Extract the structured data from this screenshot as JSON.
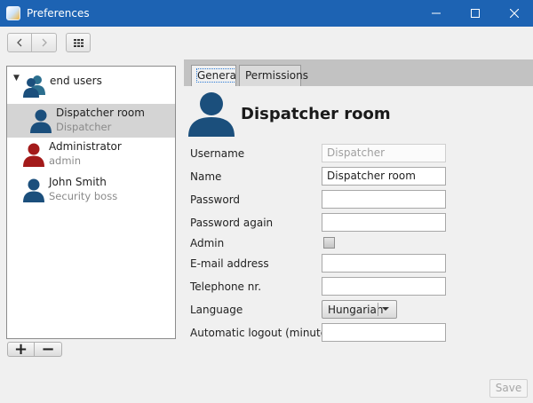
{
  "window": {
    "title": "Preferences",
    "controls": [
      "minimize-icon",
      "maximize-icon",
      "close-icon"
    ]
  },
  "toolbar": {
    "buttons": [
      "back-arrow-icon",
      "forward-arrow-icon",
      "grid-menu-icon"
    ]
  },
  "tree": {
    "root_label": "end users",
    "items": [
      {
        "name": "Dispatcher room",
        "role": "Dispatcher",
        "selected": true,
        "icon_color": "#1b4f7c"
      },
      {
        "name": "Administrator",
        "role": "admin",
        "selected": false,
        "icon_color": "#a31a1a"
      },
      {
        "name": "John Smith",
        "role": "Security boss",
        "selected": false,
        "icon_color": "#1b4f7c"
      }
    ],
    "add_label": "+",
    "remove_label": "−"
  },
  "tabs": [
    {
      "label": "General",
      "active": true
    },
    {
      "label": "Permissions",
      "active": false
    }
  ],
  "detail": {
    "title": "Dispatcher room",
    "fields": {
      "username_label": "Username",
      "username_value": "Dispatcher",
      "name_label": "Name",
      "name_value": "Dispatcher room",
      "password_label": "Password",
      "password_value": "",
      "password_again_label": "Password again",
      "password_again_value": "",
      "admin_label": "Admin",
      "admin_checked": false,
      "email_label": "E-mail address",
      "email_value": "",
      "telephone_label": "Telephone nr.",
      "telephone_value": "",
      "language_label": "Language",
      "language_value": "Hungarian",
      "logout_label": "Automatic logout (minutes)",
      "logout_value": ""
    }
  },
  "footer": {
    "save_label": "Save",
    "save_enabled": false
  },
  "colors": {
    "titlebar": "#1d63b3",
    "user_icon_blue": "#1b4f7c",
    "user_icon_red": "#a31a1a",
    "selection": "#d4d4d4"
  }
}
